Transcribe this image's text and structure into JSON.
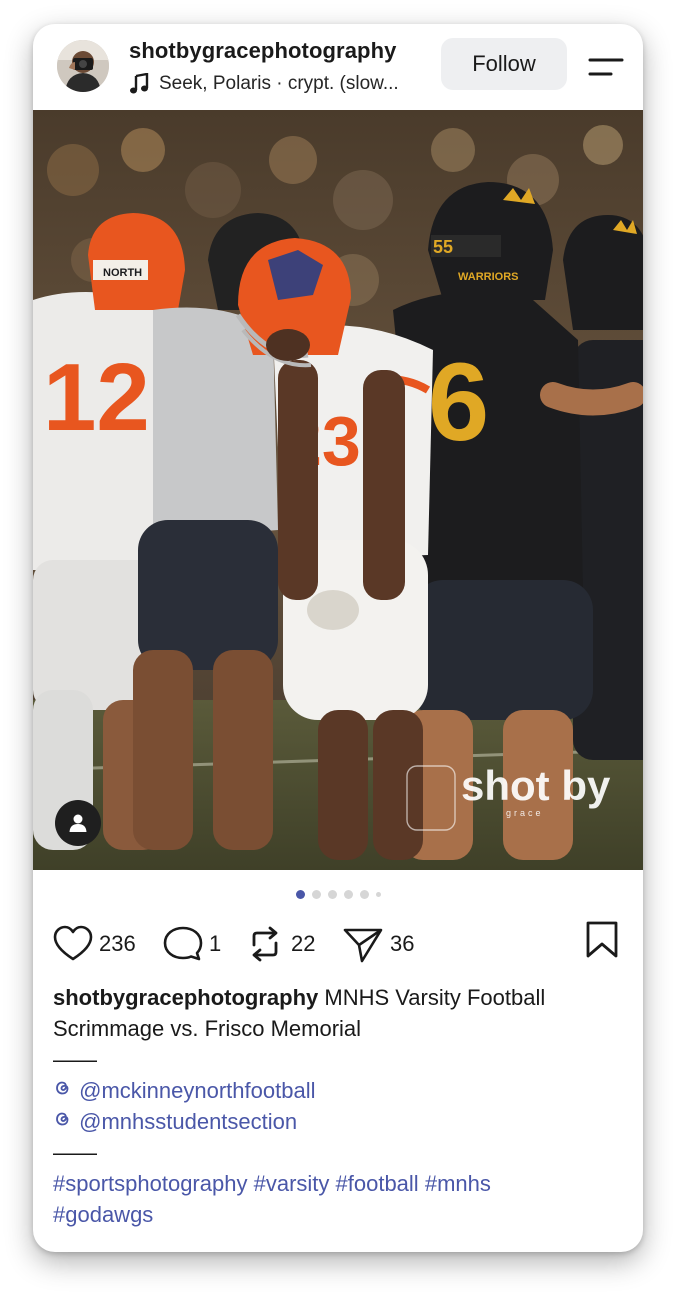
{
  "post": {
    "username": "shotbygracephotography",
    "music": "Seek, Polaris · crypt. (slow...",
    "follow_label": "Follow"
  },
  "watermark": {
    "line1": "shot by",
    "line2": "grace"
  },
  "carousel": {
    "total_dots": 6,
    "active_index": 0
  },
  "actions": {
    "likes": "236",
    "comments": "1",
    "reposts": "22",
    "shares": "36"
  },
  "caption": {
    "username": "shotbygracephotography",
    "text_line1": "MNHS Varsity Football",
    "text_line2": "Scrimmage vs. Frisco Memorial",
    "divider1": "——",
    "mention1": "@mckinneynorthfootball",
    "mention2": "@mnhsstudentsection",
    "divider2": "——",
    "hashtags_line1": [
      "#sportsphotography",
      "#varsity",
      "#football",
      "#mnhs"
    ],
    "hashtags_line2": [
      "#godawgs"
    ]
  },
  "jerseys": {
    "left_player": "12",
    "center_player": "23",
    "right_player": "6",
    "helmet_text": "NORTH",
    "helmet_number": "55",
    "helmet_team": "WARRIORS"
  },
  "colors": {
    "accent_blue": "#4a57a8",
    "follow_bg": "#eeeff1",
    "team_orange": "#e8561f",
    "team_black": "#1c1c1e",
    "team_gold": "#e0a825"
  },
  "icons": [
    "music-note-icon",
    "menu-icon",
    "heart-icon",
    "comment-icon",
    "repost-icon",
    "share-icon",
    "bookmark-icon",
    "person-icon",
    "threads-icon"
  ]
}
